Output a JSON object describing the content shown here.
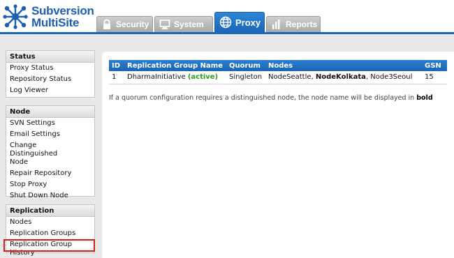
{
  "app": {
    "logo_line1": "Subversion",
    "logo_line2": "MultiSite",
    "brand_color": "#1f5fb0"
  },
  "tabs": [
    {
      "label": "Security",
      "icon": "lock-icon",
      "active": false
    },
    {
      "label": "System",
      "icon": "monitor-icon",
      "active": false
    },
    {
      "label": "Proxy",
      "icon": "globe-icon",
      "active": true
    },
    {
      "label": "Reports",
      "icon": "bar-chart-icon",
      "active": false
    }
  ],
  "sidebar": {
    "status": {
      "title": "Status",
      "items": [
        "Proxy Status",
        "Repository Status",
        "Log Viewer"
      ]
    },
    "node": {
      "title": "Node",
      "items": [
        "SVN Settings",
        "Email Settings",
        "Change Distinguished Node",
        "Repair Repository",
        "Stop Proxy",
        "Shut Down Node"
      ]
    },
    "replication": {
      "title": "Replication",
      "items": [
        "Nodes",
        "Replication Groups",
        "Replication Group History"
      ]
    }
  },
  "table": {
    "headers": [
      "ID",
      "Replication Group Name",
      "Quorum",
      "Nodes",
      "GSN"
    ],
    "rows": [
      {
        "id": "1",
        "name": "DharmaInitiative",
        "status": "(active)",
        "quorum": "Singleton",
        "node_a": "NodeSeattle,",
        "node_b": "NodeKolkata",
        "node_c": ", Node3Seoul",
        "gsn": "15"
      }
    ]
  },
  "note": {
    "text": "If a quorum configuration requires a distinguished node, the node name will be displayed in",
    "bold_word": "bold"
  }
}
